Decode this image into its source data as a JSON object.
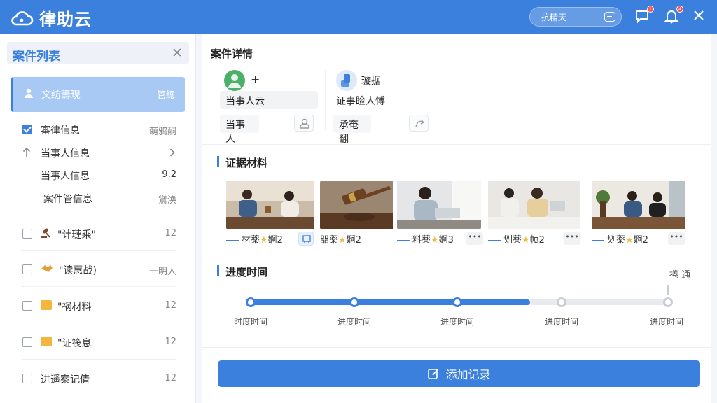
{
  "app": {
    "title": "律助云"
  },
  "topbar": {
    "search_label": "抗精天",
    "notif_badge_1": "1",
    "notif_badge_2": "4"
  },
  "sidebar": {
    "title": "案件列表",
    "active": {
      "label": "文纺籌现",
      "meta": "管總"
    },
    "items": [
      {
        "label": "審律信息",
        "meta": "萌鸦酮",
        "checked": true
      },
      {
        "label": "当事人信息",
        "meta": ""
      },
      {
        "label": "当事人信息",
        "meta": "9.2"
      },
      {
        "label": "案件管信息",
        "meta": "䳷涣"
      },
      {
        "label": "\"计璉乘\"",
        "meta": "12"
      },
      {
        "label": "\"读惠战)",
        "meta": "一明人"
      },
      {
        "label": "\"祸材料",
        "meta": "12"
      },
      {
        "label": "\"证筏息",
        "meta": "12"
      },
      {
        "label": "进遥案记倩",
        "meta": "12"
      }
    ]
  },
  "details": {
    "title": "案件详情",
    "party_a": {
      "plus": "+",
      "name": "当事人云",
      "role": "当事人"
    },
    "party_b": {
      "label": "璇据",
      "name": "证事睑人愽",
      "role": "承奄翻"
    }
  },
  "evidence": {
    "title": "证据材料",
    "items": [
      {
        "caption": "材薬",
        "suffix": "婀2"
      },
      {
        "caption": "㗊薬",
        "suffix": "婀2"
      },
      {
        "caption": "料薬",
        "suffix": "婀3"
      },
      {
        "caption": "㓶薬",
        "suffix": "帧2"
      },
      {
        "caption": "㓶薬",
        "suffix": "婀2"
      }
    ]
  },
  "progress": {
    "title": "进度时间",
    "side_label": "捲 通",
    "value": 0.67,
    "steps": [
      "时度时间",
      "进度时间",
      "进度时间",
      "进度时间",
      "进度时间"
    ]
  },
  "actions": {
    "add_record": "添加记录"
  },
  "colors": {
    "primary": "#3c80dd",
    "accent": "#f4b63c",
    "badge": "#f5515f"
  }
}
